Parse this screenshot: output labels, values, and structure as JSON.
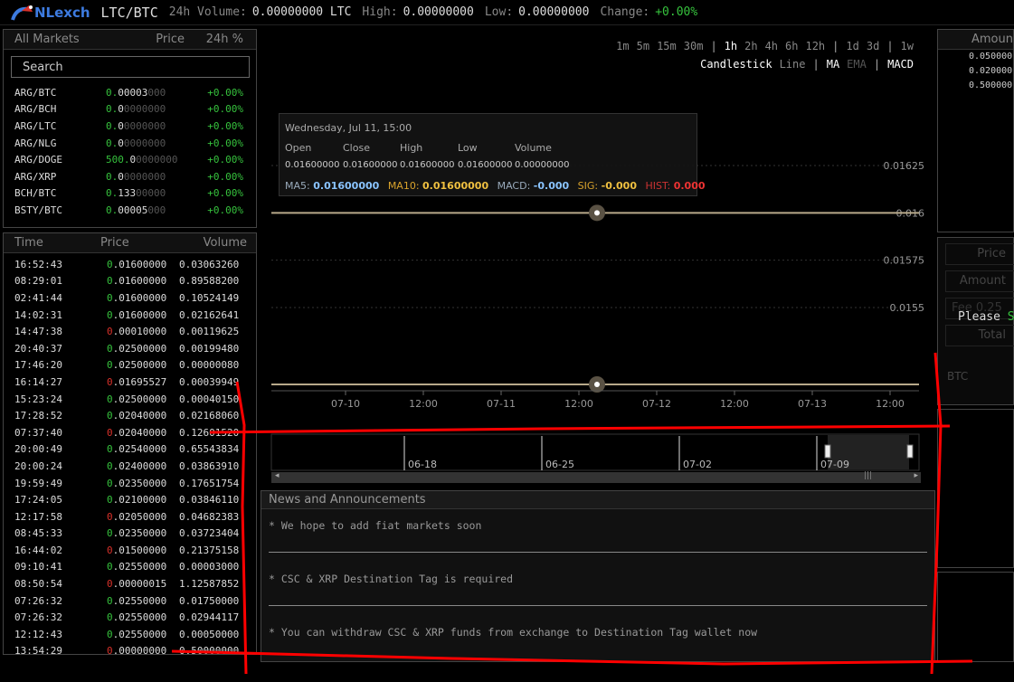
{
  "header": {
    "logo_text": "NLexch",
    "pair": "LTC/BTC",
    "volume_label": "24h Volume:",
    "volume_value": "0.00000000 LTC",
    "high_label": "High:",
    "high_value": "0.00000000",
    "low_label": "Low:",
    "low_value": "0.00000000",
    "change_label": "Change:",
    "change_value": "+0.00%"
  },
  "markets": {
    "header": [
      "All Markets",
      "Price",
      "24h %"
    ],
    "search_placeholder": "Search",
    "rows": [
      {
        "name": "ARG/BTC",
        "price_lead": "0.",
        "price_main": "00003",
        "price_tail": "000",
        "change": "+0.00%"
      },
      {
        "name": "ARG/BCH",
        "price_lead": "0.",
        "price_main": "0",
        "price_tail": "0000000",
        "change": "+0.00%"
      },
      {
        "name": "ARG/LTC",
        "price_lead": "0.",
        "price_main": "0",
        "price_tail": "0000000",
        "change": "+0.00%"
      },
      {
        "name": "ARG/NLG",
        "price_lead": "0.",
        "price_main": "0",
        "price_tail": "0000000",
        "change": "+0.00%"
      },
      {
        "name": "ARG/DOGE",
        "price_lead": "500.",
        "price_main": "0",
        "price_tail": "0000000",
        "change": "+0.00%"
      },
      {
        "name": "ARG/XRP",
        "price_lead": "0.",
        "price_main": "0",
        "price_tail": "0000000",
        "change": "+0.00%"
      },
      {
        "name": "BCH/BTC",
        "price_lead": "0.",
        "price_main": "133",
        "price_tail": "00000",
        "change": "+0.00%"
      },
      {
        "name": "BSTY/BTC",
        "price_lead": "0.",
        "price_main": "00005",
        "price_tail": "000",
        "change": "+0.00%"
      }
    ]
  },
  "trades": {
    "header": [
      "Time",
      "Price",
      "Volume"
    ],
    "rows": [
      {
        "time": "16:52:43",
        "dir": "up",
        "price": ".01600000",
        "vol": "0.03063260"
      },
      {
        "time": "08:29:01",
        "dir": "up",
        "price": ".01600000",
        "vol": "0.89588200"
      },
      {
        "time": "02:41:44",
        "dir": "up",
        "price": ".01600000",
        "vol": "0.10524149"
      },
      {
        "time": "14:02:31",
        "dir": "up",
        "price": ".01600000",
        "vol": "0.02162641"
      },
      {
        "time": "14:47:38",
        "dir": "down",
        "price": ".00010000",
        "vol": "0.00119625"
      },
      {
        "time": "20:40:37",
        "dir": "up",
        "price": ".02500000",
        "vol": "0.00199480"
      },
      {
        "time": "17:46:20",
        "dir": "up",
        "price": ".02500000",
        "vol": "0.00000080"
      },
      {
        "time": "16:14:27",
        "dir": "down",
        "price": ".01695527",
        "vol": "0.00039949"
      },
      {
        "time": "15:23:24",
        "dir": "up",
        "price": ".02500000",
        "vol": "0.00040150"
      },
      {
        "time": "17:28:52",
        "dir": "up",
        "price": ".02040000",
        "vol": "0.02168060"
      },
      {
        "time": "07:37:40",
        "dir": "down",
        "price": ".02040000",
        "vol": "0.12601520"
      },
      {
        "time": "20:00:49",
        "dir": "up",
        "price": ".02540000",
        "vol": "0.65543834"
      },
      {
        "time": "20:00:24",
        "dir": "up",
        "price": ".02400000",
        "vol": "0.03863910"
      },
      {
        "time": "19:59:49",
        "dir": "up",
        "price": ".02350000",
        "vol": "0.17651754"
      },
      {
        "time": "17:24:05",
        "dir": "up",
        "price": ".02100000",
        "vol": "0.03846110"
      },
      {
        "time": "12:17:58",
        "dir": "down",
        "price": ".02050000",
        "vol": "0.04682383"
      },
      {
        "time": "08:45:33",
        "dir": "up",
        "price": ".02350000",
        "vol": "0.03723404"
      },
      {
        "time": "16:44:02",
        "dir": "down",
        "price": ".01500000",
        "vol": "0.21375158"
      },
      {
        "time": "09:10:41",
        "dir": "up",
        "price": ".02550000",
        "vol": "0.00003000"
      },
      {
        "time": "08:50:54",
        "dir": "down",
        "price": ".00000015",
        "vol": "1.12587852"
      },
      {
        "time": "07:26:32",
        "dir": "up",
        "price": ".02550000",
        "vol": "0.01750000"
      },
      {
        "time": "07:26:32",
        "dir": "up",
        "price": ".02550000",
        "vol": "0.02944117"
      },
      {
        "time": "12:12:43",
        "dir": "up",
        "price": ".02550000",
        "vol": "0.00050000"
      },
      {
        "time": "13:54:29",
        "dir": "down",
        "price": ".00000000",
        "vol": "0.50000000"
      }
    ]
  },
  "chart": {
    "periods": [
      "1m",
      "5m",
      "15m",
      "30m",
      "|",
      "1h",
      "2h",
      "4h",
      "6h",
      "12h",
      "|",
      "1d",
      "3d",
      "|",
      "1w"
    ],
    "selected_period": "1h",
    "indicators": [
      "Candlestick",
      "Line",
      "|",
      "MA",
      "EMA",
      "|",
      "MACD"
    ],
    "tooltip": {
      "date": "Wednesday, Jul 11, 15:00",
      "headers": [
        "Open",
        "Close",
        "High",
        "Low",
        "Volume"
      ],
      "values": [
        "0.01600000",
        "0.01600000",
        "0.01600000",
        "0.01600000",
        "0.00000000"
      ],
      "ma5_label": "MA5:",
      "ma5": "0.01600000",
      "ma10_label": "MA10:",
      "ma10": "0.01600000",
      "macd_label": "MACD:",
      "macd": "-0.000",
      "sig_label": "SIG:",
      "sig": "-0.000",
      "hist_label": "HIST:",
      "hist": "0.000"
    },
    "y_ticks": [
      "0.01625",
      "0.016",
      "0.01575",
      "0.0155"
    ],
    "x_ticks": [
      "07-10",
      "12:00",
      "07-11",
      "12:00",
      "07-12",
      "12:00",
      "07-13",
      "12:00"
    ],
    "nav_ticks": [
      "06-18",
      "06-25",
      "07-02",
      "07-09"
    ]
  },
  "chart_data": {
    "type": "line",
    "x": [
      "07-10",
      "07-11",
      "07-12",
      "07-13"
    ],
    "series": [
      {
        "values": [
          0.016,
          0.016,
          0.016,
          0.016
        ]
      }
    ],
    "ylim": [
      0.0155,
      0.01625
    ]
  },
  "news": {
    "title": "News and Announcements",
    "items": [
      "* We hope to add fiat markets soon",
      "* CSC & XRP Destination Tag is required",
      "* You can withdraw CSC & XRP funds from exchange to Destination Tag wallet now"
    ]
  },
  "orderbook": {
    "header": "Amoun",
    "rows": [
      "0.050000",
      "0.020000",
      "0.500000"
    ]
  },
  "order_form": {
    "price": "Price",
    "amount": "Amount",
    "fee": "Fee 0.25",
    "total": "Total",
    "please": "Please",
    "please_link": "S",
    "currency": "BTC"
  },
  "colors": {
    "accent": "#3d7be0",
    "up": "#36c23d",
    "down": "#d9312a",
    "annotation": "#ff0000"
  }
}
